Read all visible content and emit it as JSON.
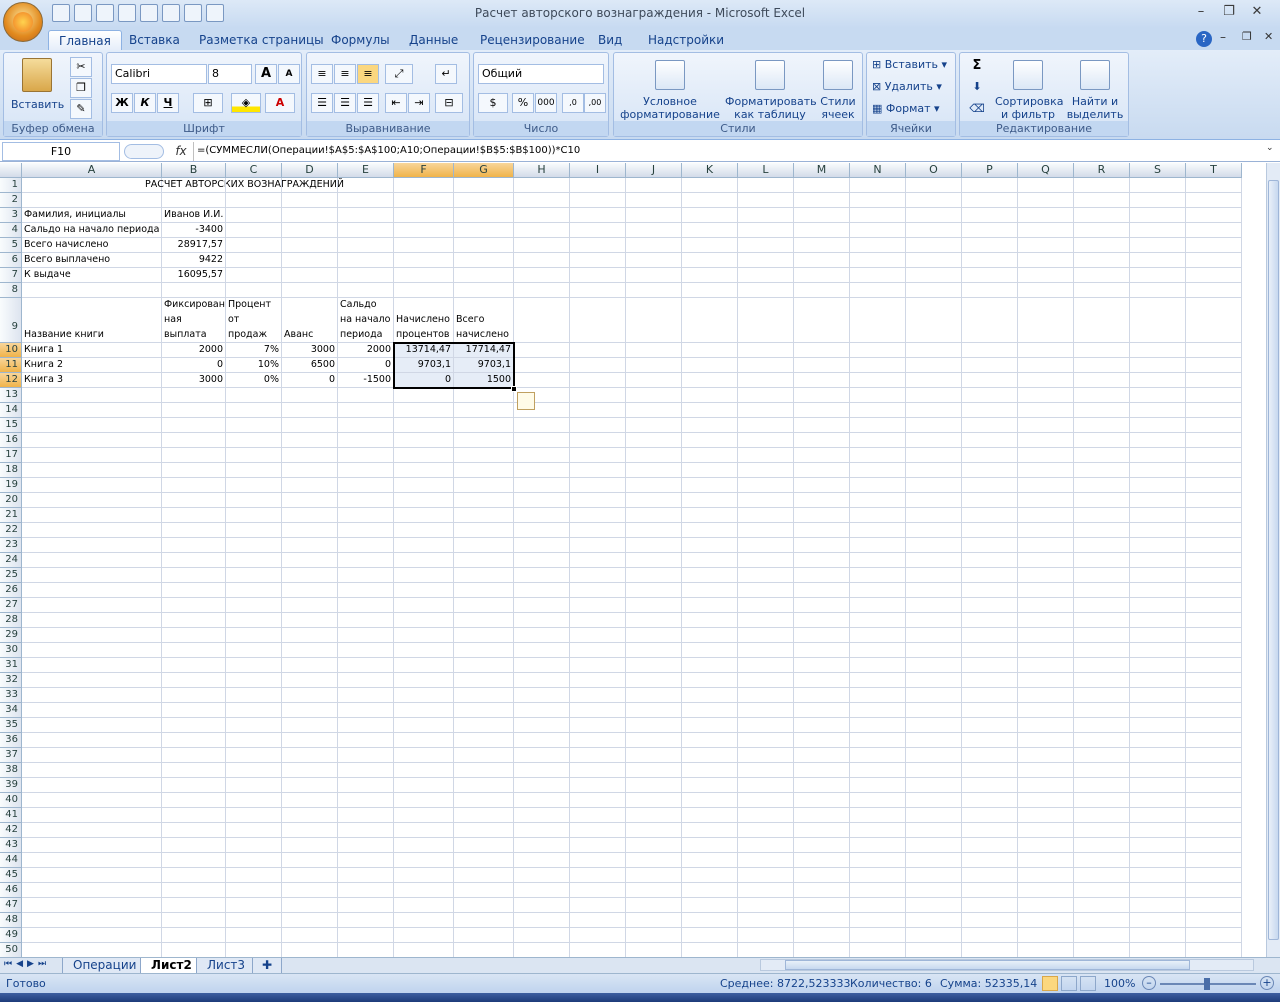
{
  "window": {
    "title": "Расчет авторского вознаграждения - Microsoft Excel"
  },
  "tabs": [
    "Главная",
    "Вставка",
    "Разметка страницы",
    "Формулы",
    "Данные",
    "Рецензирование",
    "Вид",
    "Надстройки"
  ],
  "ribbon": {
    "clipboard": {
      "title": "Буфер обмена",
      "paste": "Вставить"
    },
    "font": {
      "title": "Шрифт",
      "name": "Calibri",
      "size": "8",
      "bold": "Ж",
      "italic": "К",
      "underline": "Ч",
      "grow": "A",
      "shrink": "A",
      "color": "A"
    },
    "alignment": {
      "title": "Выравнивание"
    },
    "number": {
      "title": "Число",
      "format": "Общий",
      "percent": "%",
      "thousands": "000"
    },
    "styles": {
      "title": "Стили",
      "conditional": "Условное форматирование",
      "table": "Форматировать как таблицу",
      "cell": "Стили ячеек"
    },
    "cells": {
      "title": "Ячейки",
      "insert": "Вставить",
      "delete": "Удалить",
      "format": "Формат"
    },
    "editing": {
      "title": "Редактирование",
      "sort": "Сортировка и фильтр",
      "find": "Найти и выделить",
      "sum": "Σ"
    }
  },
  "formula_bar": {
    "name_box": "F10",
    "fx": "fx",
    "formula": "=(СУММЕСЛИ(Операции!$A$5:$A$100;A10;Операции!$B$5:$B$100))*C10"
  },
  "columns": [
    "A",
    "B",
    "C",
    "D",
    "E",
    "F",
    "G",
    "H",
    "I",
    "J",
    "K",
    "L",
    "M",
    "N",
    "O",
    "P",
    "Q",
    "R",
    "S",
    "T"
  ],
  "cells": {
    "r1": {
      "A": "РАСЧЕТ АВТОРСКИХ ВОЗНАГРАЖДЕНИЙ"
    },
    "r3": {
      "A": "Фамилия, инициалы",
      "B": "Иванов И.И."
    },
    "r4": {
      "A": "Сальдо на начало периода",
      "B": "-3400"
    },
    "r5": {
      "A": "Всего начислено",
      "B": "28917,57"
    },
    "r6": {
      "A": "Всего выплачено",
      "B": "9422"
    },
    "r7": {
      "A": "К выдаче",
      "B": "16095,57"
    },
    "r9": {
      "A": "Название книги",
      "B": "Фиксирован ная выплата",
      "C": "Процент от продаж",
      "D": "Аванс",
      "E": "Сальдо на начало периода",
      "F": "Начислено процентов",
      "G": "Всего начислено"
    },
    "r10": {
      "A": "Книга 1",
      "B": "2000",
      "C": "7%",
      "D": "3000",
      "E": "2000",
      "F": "13714,47",
      "G": "17714,47"
    },
    "r11": {
      "A": "Книга 2",
      "B": "0",
      "C": "10%",
      "D": "6500",
      "E": "0",
      "F": "9703,1",
      "G": "9703,1"
    },
    "r12": {
      "A": "Книга 3",
      "B": "3000",
      "C": "0%",
      "D": "0",
      "E": "-1500",
      "F": "0",
      "G": "1500"
    }
  },
  "sheets": [
    "Операции",
    "Лист2",
    "Лист3"
  ],
  "status": {
    "ready": "Готово",
    "average": "Среднее: 8722,523333",
    "count": "Количество: 6",
    "sum": "Сумма: 52335,14",
    "zoom": "100%"
  }
}
